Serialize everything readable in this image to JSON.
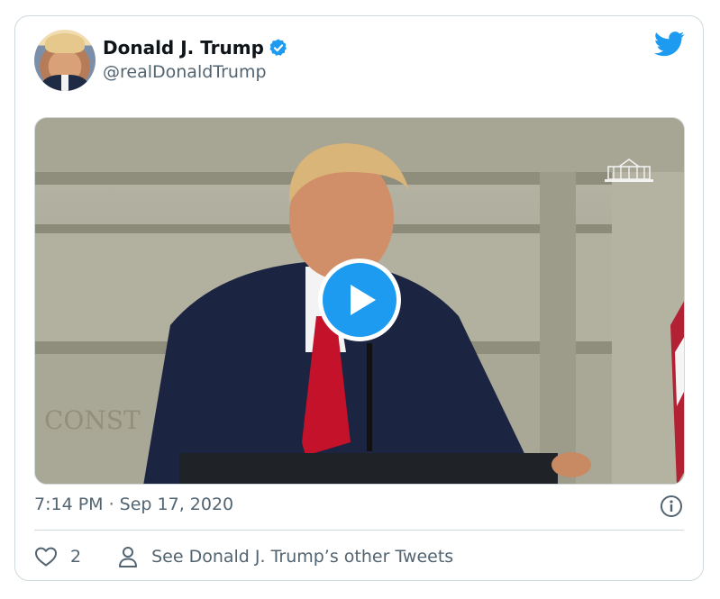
{
  "tweet": {
    "display_name": "Donald J. Trump",
    "handle": "@realDonaldTrump",
    "timestamp": "7:14 PM · Sep 17, 2020",
    "likes": "2",
    "other_tweets_label": "See Donald J. Trump’s other Tweets"
  },
  "icons": {
    "verified": "verified-badge-icon",
    "brand": "twitter-bird-icon",
    "play": "play-icon",
    "info": "info-icon",
    "like": "heart-icon",
    "profile": "person-icon"
  },
  "colors": {
    "accent": "#1d9bf0",
    "text_primary": "#0f1419",
    "text_secondary": "#536471",
    "border": "#cfd9de"
  }
}
